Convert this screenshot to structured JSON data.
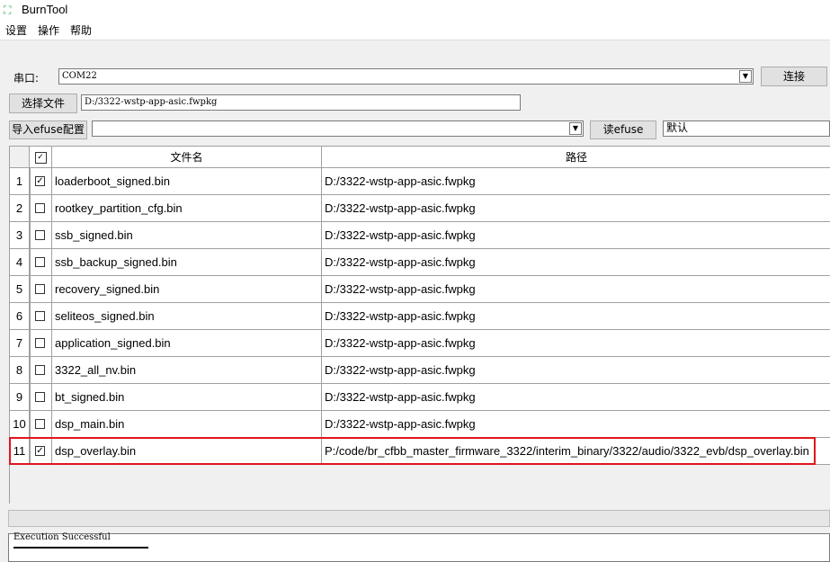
{
  "window": {
    "title": "BurnTool",
    "icon": "burntool-logo-icon"
  },
  "menu": [
    "设置",
    "操作",
    "帮助"
  ],
  "port": {
    "label": "串口:",
    "value": "COM22",
    "connect_label": "连接"
  },
  "file": {
    "select_label": "选择文件",
    "path": "D:/3322-wstp-app-asic.fwpkg"
  },
  "efuse": {
    "import_label": "导入efuse配置",
    "config_value": "",
    "read_label": "读efuse",
    "mode_value": "默认"
  },
  "table": {
    "header_check_icon": "check-all-icon",
    "columns": [
      "文件名",
      "路径"
    ],
    "rows": [
      {
        "num": "1",
        "checked": true,
        "name": "loaderboot_signed.bin",
        "path": "D:/3322-wstp-app-asic.fwpkg"
      },
      {
        "num": "2",
        "checked": false,
        "name": "rootkey_partition_cfg.bin",
        "path": "D:/3322-wstp-app-asic.fwpkg"
      },
      {
        "num": "3",
        "checked": false,
        "name": "ssb_signed.bin",
        "path": "D:/3322-wstp-app-asic.fwpkg"
      },
      {
        "num": "4",
        "checked": false,
        "name": "ssb_backup_signed.bin",
        "path": "D:/3322-wstp-app-asic.fwpkg"
      },
      {
        "num": "5",
        "checked": false,
        "name": "recovery_signed.bin",
        "path": "D:/3322-wstp-app-asic.fwpkg"
      },
      {
        "num": "6",
        "checked": false,
        "name": "seliteos_signed.bin",
        "path": "D:/3322-wstp-app-asic.fwpkg"
      },
      {
        "num": "7",
        "checked": false,
        "name": "application_signed.bin",
        "path": "D:/3322-wstp-app-asic.fwpkg"
      },
      {
        "num": "8",
        "checked": false,
        "name": "3322_all_nv.bin",
        "path": "D:/3322-wstp-app-asic.fwpkg"
      },
      {
        "num": "9",
        "checked": false,
        "name": "bt_signed.bin",
        "path": "D:/3322-wstp-app-asic.fwpkg"
      },
      {
        "num": "10",
        "checked": false,
        "name": "dsp_main.bin",
        "path": "D:/3322-wstp-app-asic.fwpkg"
      },
      {
        "num": "11",
        "checked": true,
        "name": "dsp_overlay.bin",
        "path": "P:/code/br_cfbb_master_firmware_3322/interim_binary/3322/audio/3322_evb/dsp_overlay.bin"
      }
    ]
  },
  "log": {
    "text": "Execution Successful"
  },
  "colors": {
    "highlight": "#e0161b"
  }
}
